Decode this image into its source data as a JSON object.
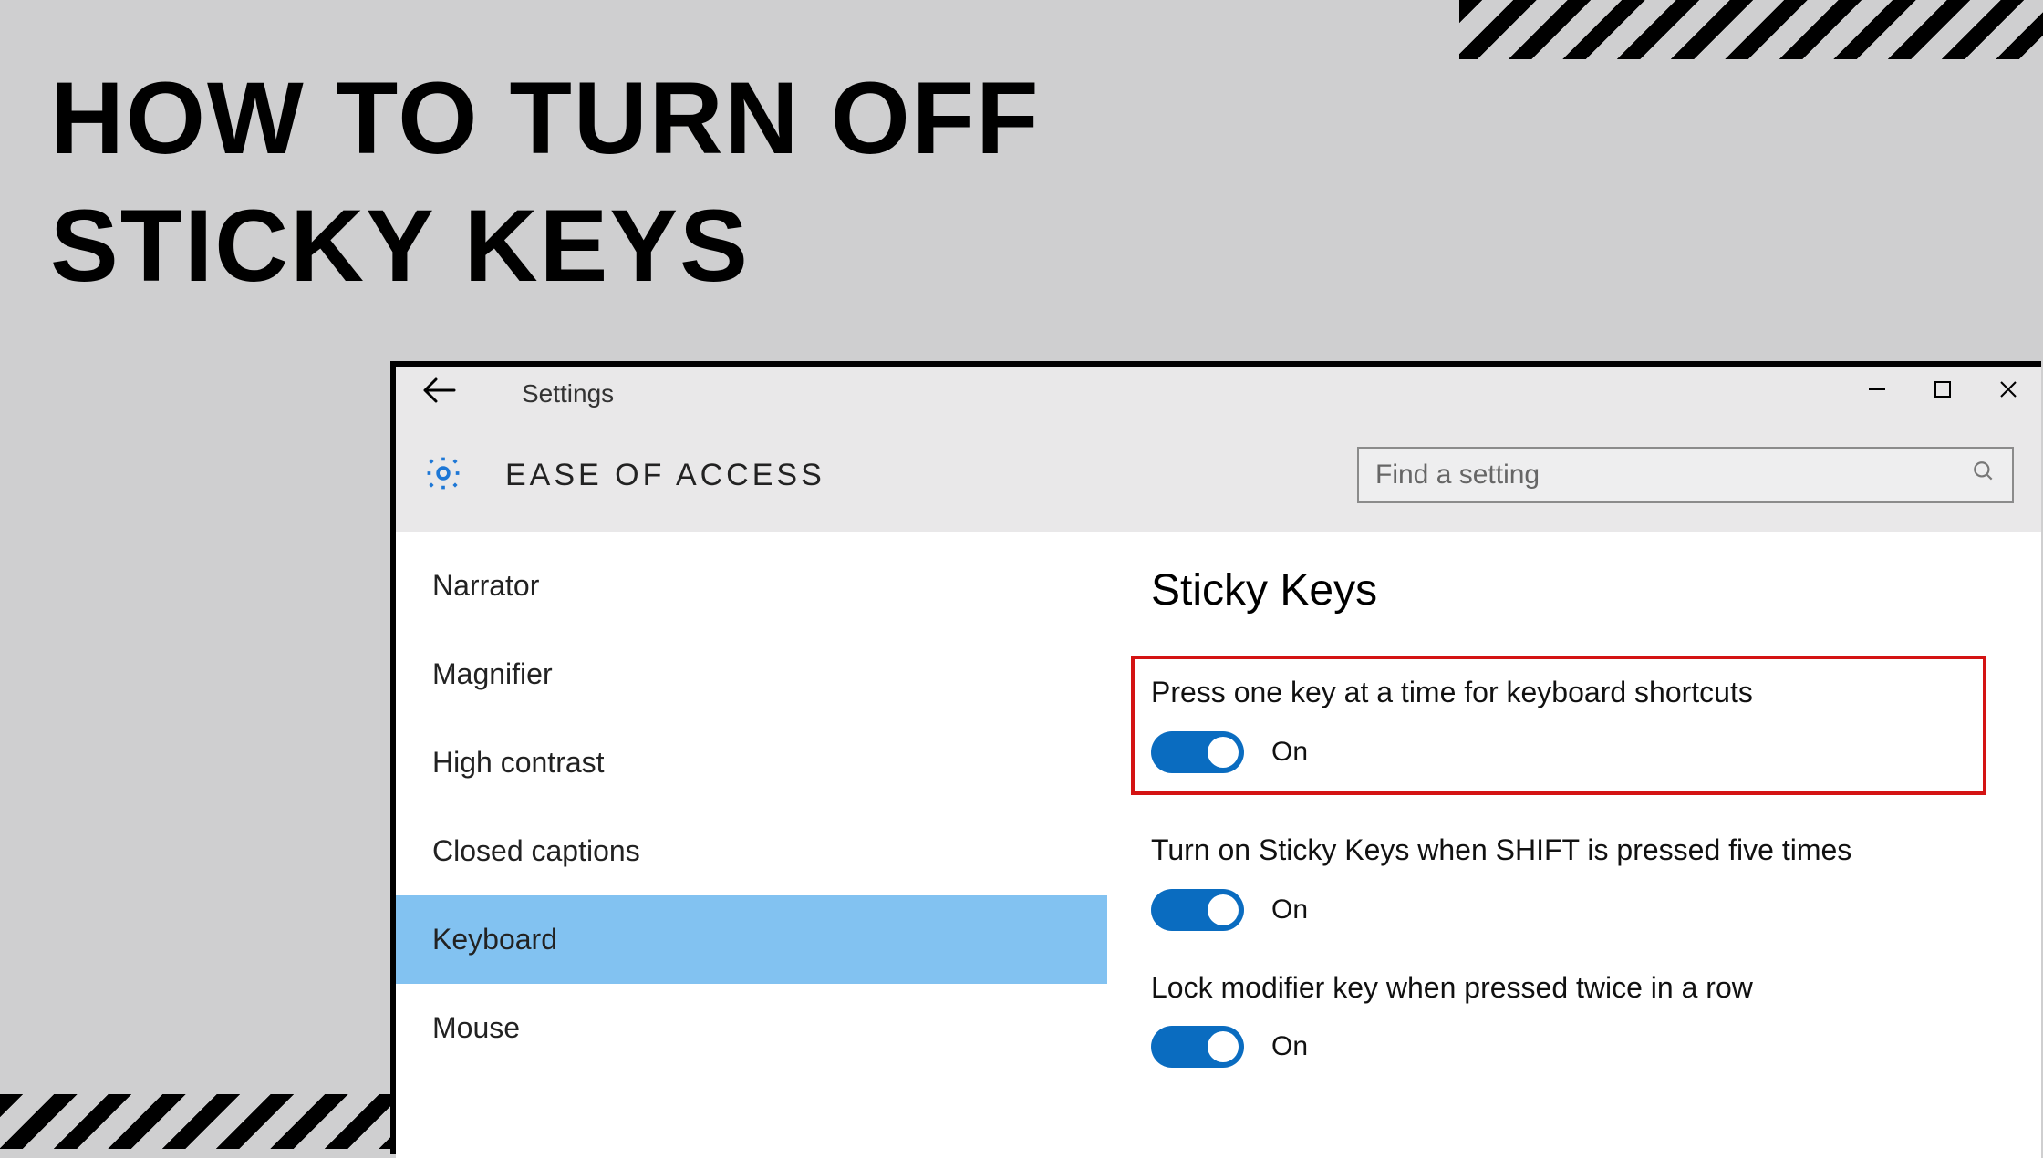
{
  "article": {
    "headline": "HOW TO TURN OFF\nSTICKY KEYS"
  },
  "window": {
    "title": "Settings",
    "section": "EASE OF ACCESS",
    "search_placeholder": "Find a setting"
  },
  "sidebar": {
    "items": [
      {
        "label": "Narrator",
        "selected": false
      },
      {
        "label": "Magnifier",
        "selected": false
      },
      {
        "label": "High contrast",
        "selected": false
      },
      {
        "label": "Closed captions",
        "selected": false
      },
      {
        "label": "Keyboard",
        "selected": true
      },
      {
        "label": "Mouse",
        "selected": false
      }
    ]
  },
  "content": {
    "heading": "Sticky Keys",
    "settings": [
      {
        "label": "Press one key at a time for keyboard shortcuts",
        "state": "On",
        "highlighted": true
      },
      {
        "label": "Turn on Sticky Keys when SHIFT is pressed five times",
        "state": "On",
        "highlighted": false
      },
      {
        "label": "Lock modifier key when pressed twice in a row",
        "state": "On",
        "highlighted": false
      }
    ]
  }
}
